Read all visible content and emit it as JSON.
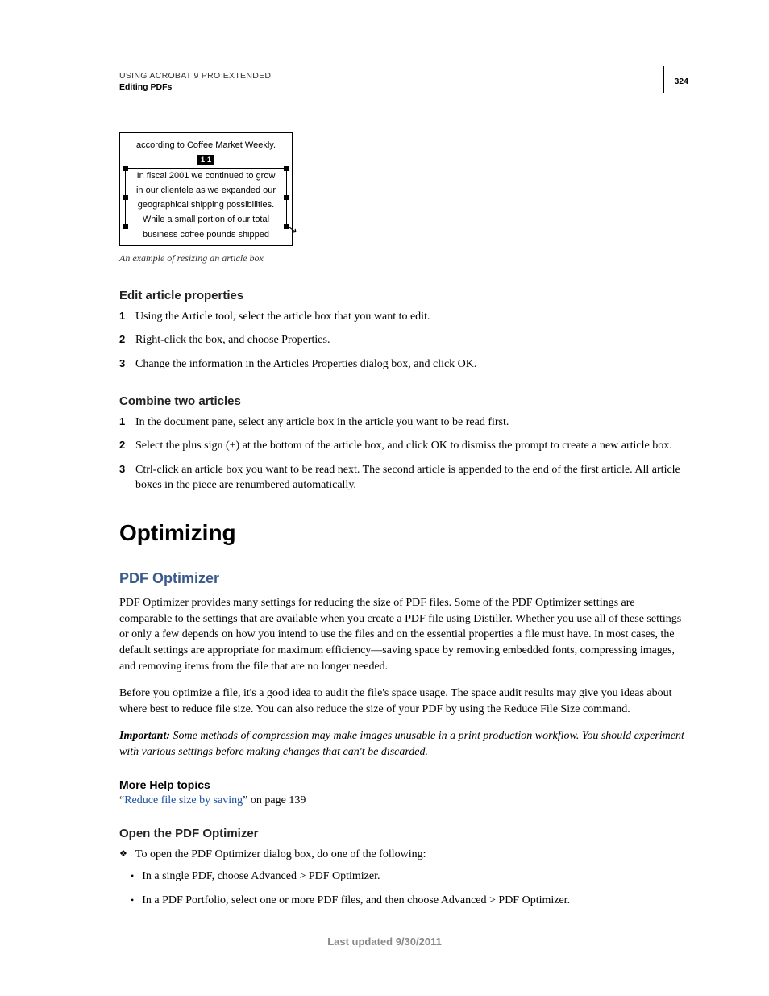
{
  "header": {
    "running_head": "USING ACROBAT 9 PRO EXTENDED",
    "chapter_tag": "Editing PDFs",
    "page_number": "324"
  },
  "figure": {
    "top_line": "according to Coffee Market Weekly.",
    "badge": "1-1",
    "lines": [
      "In fiscal 2001 we continued to grow",
      "in our clientele as we expanded our",
      "geographical shipping possibilities.",
      "While a small portion of our total"
    ],
    "overflow_line": "business coffee pounds shipped",
    "caption": "An example of resizing an article box"
  },
  "edit_article": {
    "heading": "Edit article properties",
    "steps": [
      "Using the Article tool, select the article box that you want to edit.",
      "Right-click the box, and choose Properties.",
      "Change the information in the Articles Properties dialog box, and click OK."
    ]
  },
  "combine_articles": {
    "heading": "Combine two articles",
    "steps": [
      "In the document pane, select any article box in the article you want to be read first.",
      "Select the plus sign (+) at the bottom of the article box, and click OK to dismiss the prompt to create a new article box.",
      "Ctrl-click an article box you want to be read next. The second article is appended to the end of the first article. All article boxes in the piece are renumbered automatically."
    ]
  },
  "optimizing": {
    "h1": "Optimizing",
    "h2": "PDF Optimizer",
    "p1": "PDF Optimizer provides many settings for reducing the size of PDF files. Some of the PDF Optimizer settings are comparable to the settings that are available when you create a PDF file using Distiller. Whether you use all of these settings or only a few depends on how you intend to use the files and on the essential properties a file must have. In most cases, the default settings are appropriate for maximum efficiency—saving space by removing embedded fonts, compressing images, and removing items from the file that are no longer needed.",
    "p2": "Before you optimize a file, it's a good idea to audit the file's space usage. The space audit results may give you ideas about where best to reduce file size. You can also reduce the size of your PDF by using the Reduce File Size command.",
    "important_label": "Important:",
    "important_text": " Some methods of compression may make images unusable in a print production workflow. You should experiment with various settings before making changes that can't be discarded.",
    "more_help": "More Help topics",
    "link_quote_open": "“",
    "link_text": "Reduce file size by saving",
    "link_tail": "” on page 139",
    "open_heading": "Open the PDF Optimizer",
    "open_intro": "To open the PDF Optimizer dialog box, do one of the following:",
    "open_bullets": [
      "In a single PDF, choose Advanced > PDF Optimizer.",
      "In a PDF Portfolio, select one or more PDF files, and then choose Advanced > PDF Optimizer."
    ]
  },
  "footer": {
    "updated": "Last updated 9/30/2011"
  }
}
